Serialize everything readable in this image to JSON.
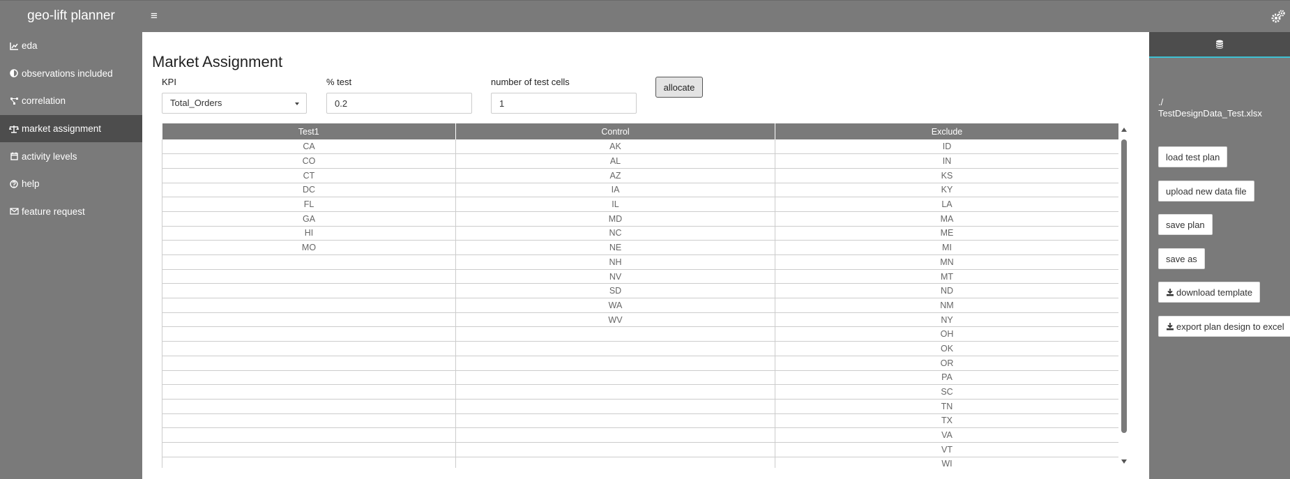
{
  "header": {
    "brand": "geo-lift planner",
    "menu_icon": "hamburger-icon",
    "settings_icon": "gears-icon"
  },
  "sidebar": {
    "items": [
      {
        "label": "eda",
        "icon": "chart-area-icon",
        "active": false
      },
      {
        "label": "observations included",
        "icon": "adjust-icon",
        "active": false
      },
      {
        "label": "correlation",
        "icon": "project-diagram-icon",
        "active": false
      },
      {
        "label": "market assignment",
        "icon": "balance-scale-icon",
        "active": true
      },
      {
        "label": "activity levels",
        "icon": "calendar-icon",
        "active": false
      },
      {
        "label": "help",
        "icon": "question-circle-icon",
        "active": false
      },
      {
        "label": "feature request",
        "icon": "envelope-icon",
        "active": false
      }
    ]
  },
  "main": {
    "title": "Market Assignment",
    "kpi": {
      "label": "KPI",
      "value": "Total_Orders"
    },
    "pct_test": {
      "label": "% test",
      "value": "0.2"
    },
    "num_cells": {
      "label": "number of test cells",
      "value": "1"
    },
    "allocate_label": "allocate",
    "table": {
      "columns": [
        "Test1",
        "Control",
        "Exclude"
      ],
      "rows": [
        [
          "CA",
          "AK",
          "ID"
        ],
        [
          "CO",
          "AL",
          "IN"
        ],
        [
          "CT",
          "AZ",
          "KS"
        ],
        [
          "DC",
          "IA",
          "KY"
        ],
        [
          "FL",
          "IL",
          "LA"
        ],
        [
          "GA",
          "MD",
          "MA"
        ],
        [
          "HI",
          "NC",
          "ME"
        ],
        [
          "MO",
          "NE",
          "MI"
        ],
        [
          "",
          "NH",
          "MN"
        ],
        [
          "",
          "NV",
          "MT"
        ],
        [
          "",
          "SD",
          "ND"
        ],
        [
          "",
          "WA",
          "NM"
        ],
        [
          "",
          "WV",
          "NY"
        ],
        [
          "",
          "",
          "OH"
        ],
        [
          "",
          "",
          "OK"
        ],
        [
          "",
          "",
          "OR"
        ],
        [
          "",
          "",
          "PA"
        ],
        [
          "",
          "",
          "SC"
        ],
        [
          "",
          "",
          "TN"
        ],
        [
          "",
          "",
          "TX"
        ],
        [
          "",
          "",
          "VA"
        ],
        [
          "",
          "",
          "VT"
        ],
        [
          "",
          "",
          "WI"
        ]
      ]
    }
  },
  "right_panel": {
    "tab_icon": "database-icon",
    "file_path_line1": "./",
    "file_path_line2": "TestDesignData_Test.xlsx",
    "buttons": {
      "load": "load test plan",
      "upload": "upload new data file",
      "save": "save plan",
      "save_as": "save as",
      "download_template": "download template",
      "export": "export plan design to excel"
    }
  },
  "colors": {
    "chrome": "#7a7a7a",
    "active": "#4d4d4d",
    "accent": "#3ec1d3"
  }
}
